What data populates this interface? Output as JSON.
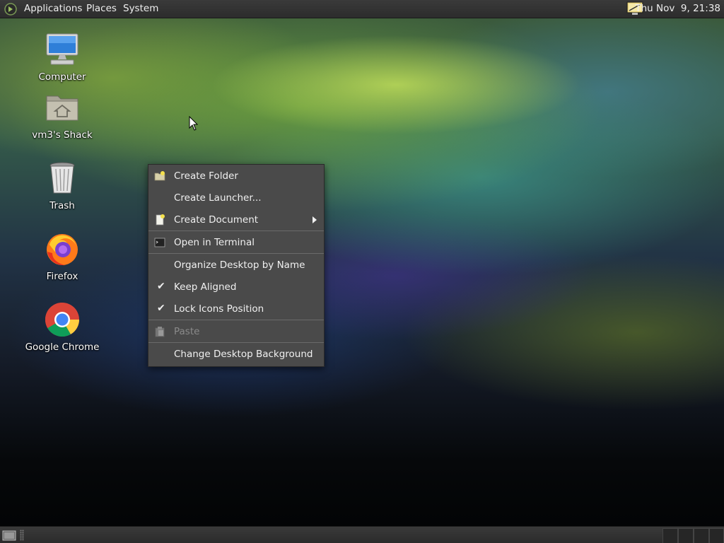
{
  "top_panel": {
    "menus": [
      "Applications",
      "Places",
      "System"
    ],
    "clock": "Thu Nov  9, 21:38",
    "logo_icon": "distro-logo-icon",
    "tray_icon": "display-icon"
  },
  "desktop": {
    "icons": [
      {
        "label": "Computer",
        "icon": "computer-icon"
      },
      {
        "label": "vm3's Shack",
        "icon": "home-folder-icon"
      },
      {
        "label": "Trash",
        "icon": "trash-icon"
      },
      {
        "label": "Firefox",
        "icon": "firefox-icon"
      },
      {
        "label": "Google Chrome",
        "icon": "chrome-icon"
      }
    ]
  },
  "context_menu": {
    "items": [
      {
        "label": "Create Folder",
        "icon": "folder-new-icon"
      },
      {
        "label": "Create Launcher...",
        "icon": ""
      },
      {
        "label": "Create Document",
        "icon": "document-new-icon",
        "submenu": true
      },
      {
        "label": "Open in Terminal",
        "icon": "terminal-icon"
      },
      {
        "label": "Organize Desktop by Name",
        "icon": ""
      },
      {
        "label": "Keep Aligned",
        "checked": true
      },
      {
        "label": "Lock Icons Position",
        "checked": true
      },
      {
        "label": "Paste",
        "icon": "paste-icon",
        "disabled": true
      },
      {
        "label": "Change Desktop Background",
        "icon": ""
      }
    ]
  },
  "bottom_panel": {
    "show_desktop_icon": "show-desktop-icon",
    "workspaces": 4
  },
  "colors": {
    "panel": "#2f2f2f",
    "menu_bg": "#4a4a4a",
    "menu_text": "#f0f0f0",
    "menu_disabled": "#8a8a8a"
  }
}
